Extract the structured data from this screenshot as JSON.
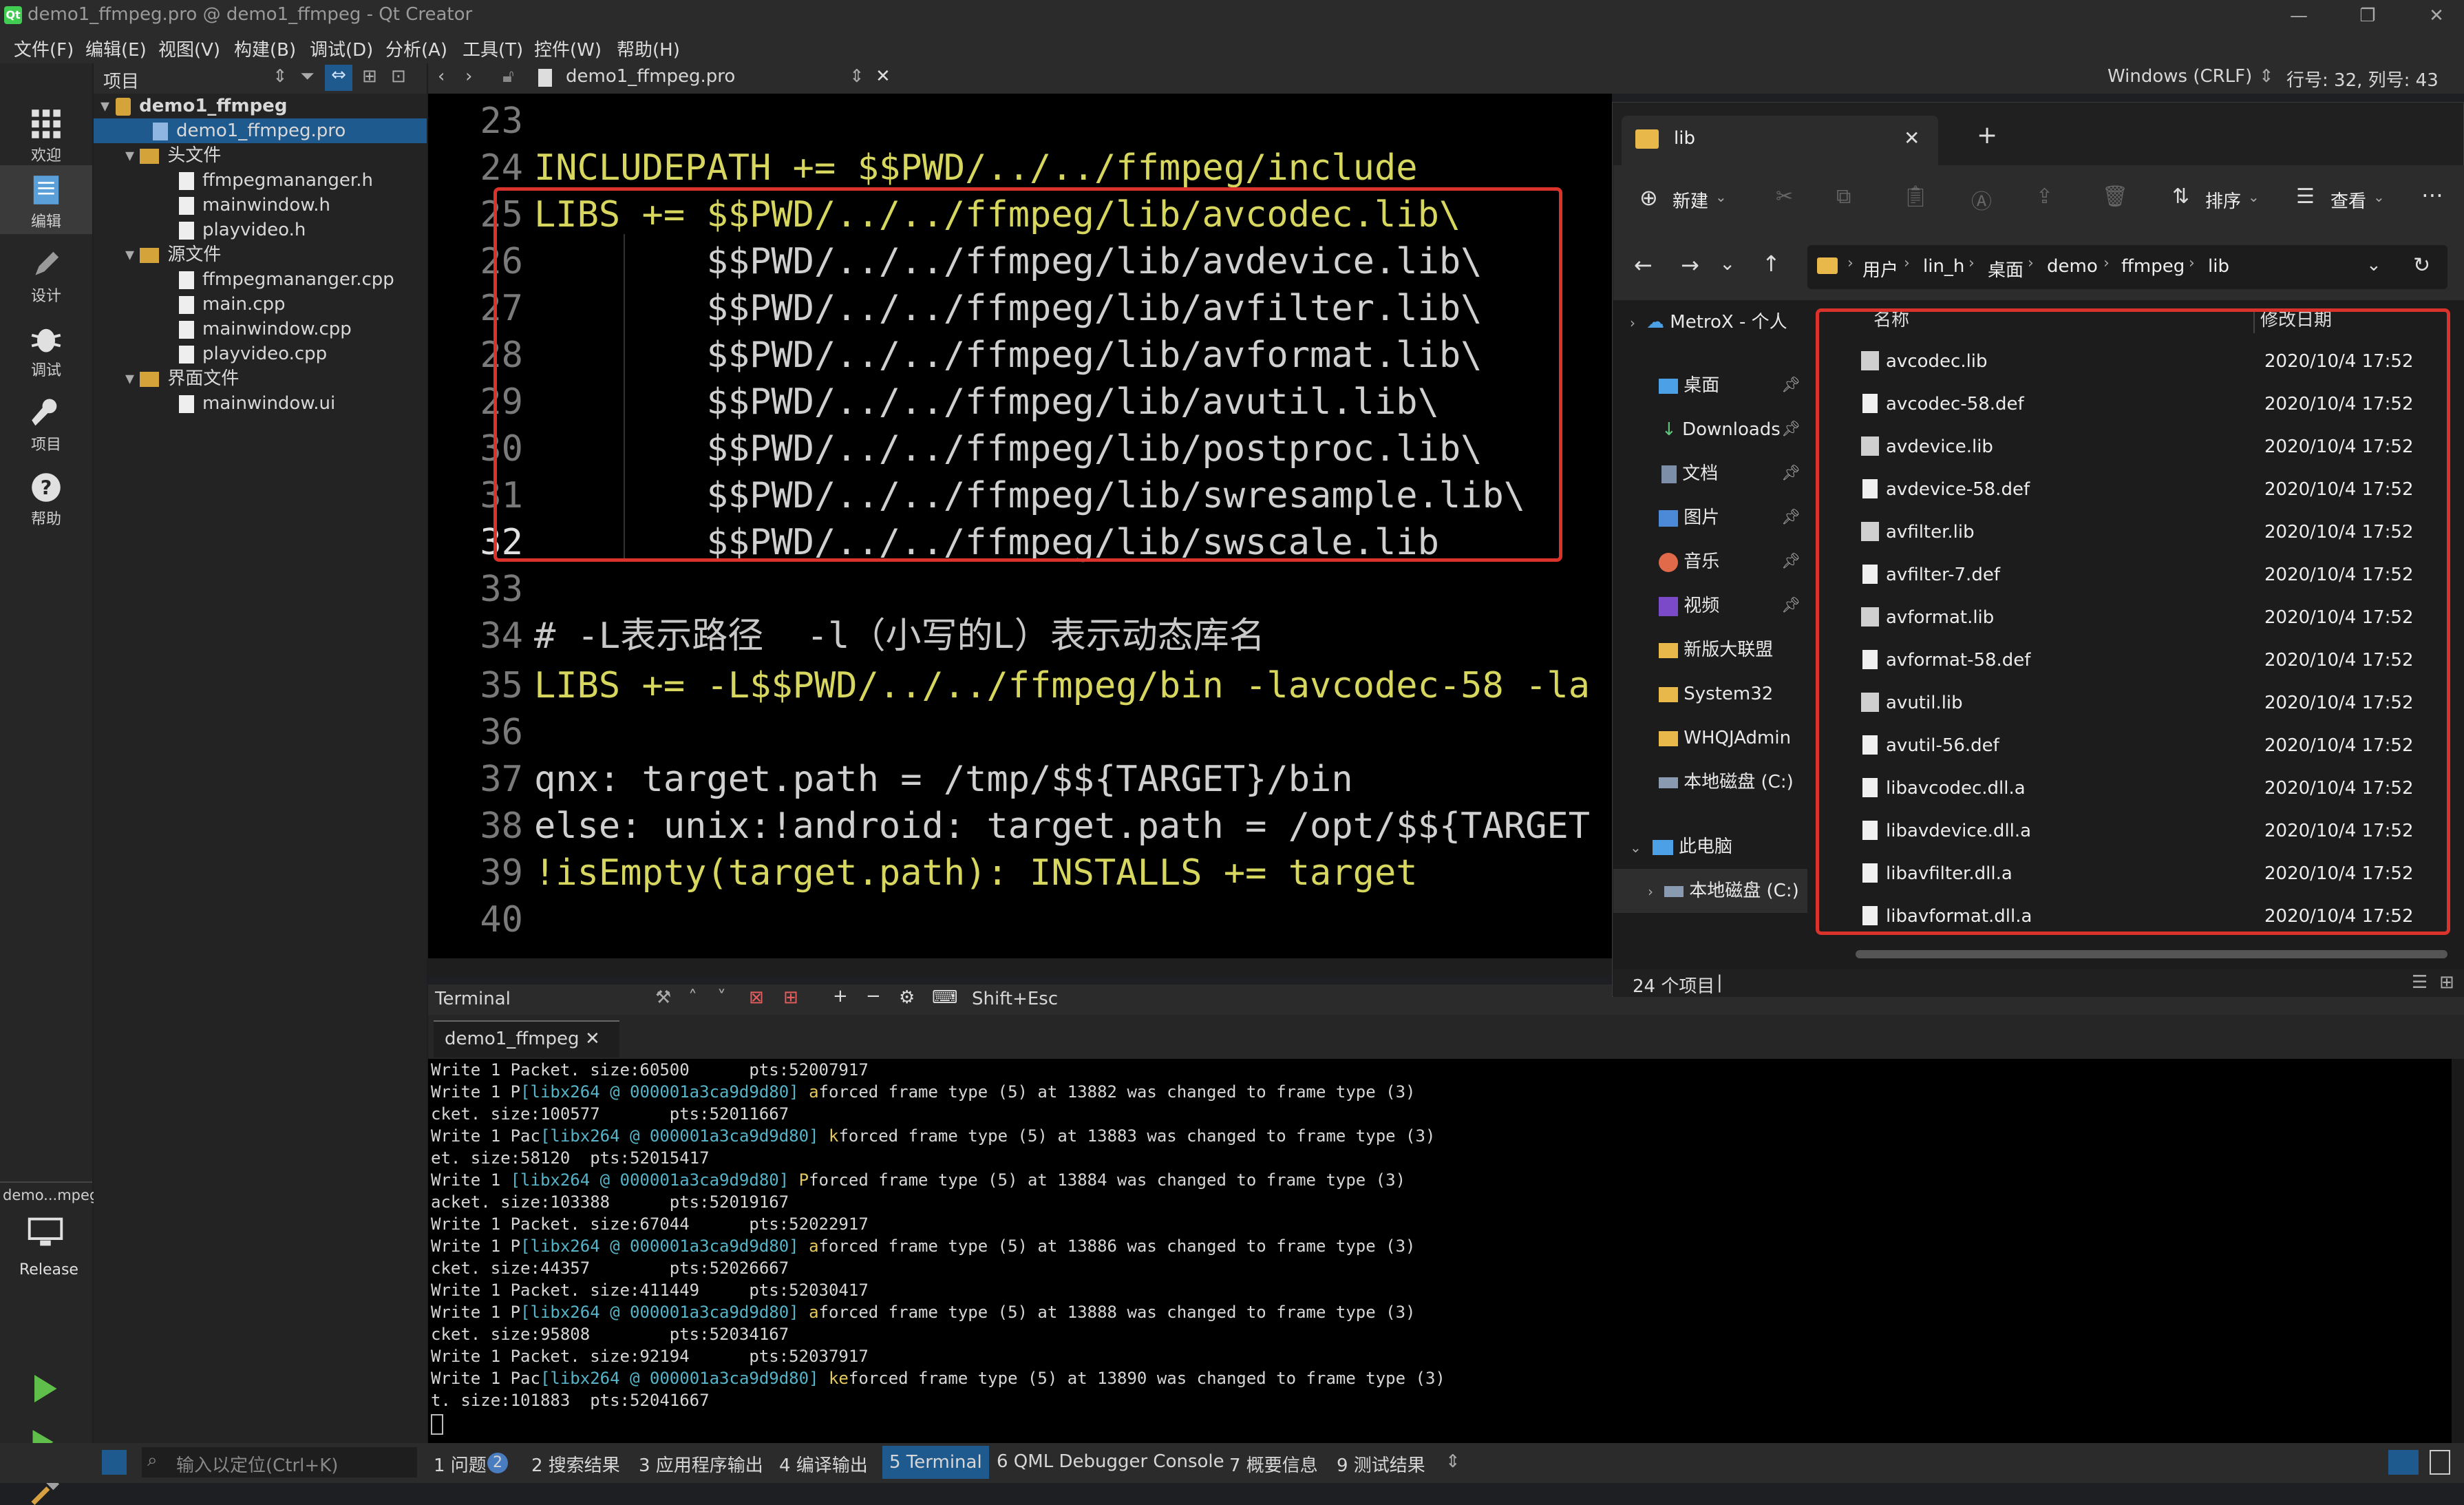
{
  "window": {
    "title": "demo1_ffmpeg.pro @ demo1_ffmpeg - Qt Creator"
  },
  "menu": [
    "文件(F)",
    "编辑(E)",
    "视图(V)",
    "构建(B)",
    "调试(D)",
    "分析(A)",
    "工具(T)",
    "控件(W)",
    "帮助(H)"
  ],
  "modes": [
    "欢迎",
    "编辑",
    "设计",
    "调试",
    "项目",
    "帮助"
  ],
  "kit": {
    "name": "demo...mpeg",
    "config": "Release"
  },
  "project": {
    "header": "项目",
    "tree": [
      {
        "label": "demo1_ffmpeg",
        "indent": 0,
        "kind": "project",
        "bold": true
      },
      {
        "label": "demo1_ffmpeg.pro",
        "indent": 1,
        "kind": "profile",
        "selected": true
      },
      {
        "label": "头文件",
        "indent": 1,
        "kind": "folder"
      },
      {
        "label": "ffmpegmananger.h",
        "indent": 2,
        "kind": "file"
      },
      {
        "label": "mainwindow.h",
        "indent": 2,
        "kind": "file"
      },
      {
        "label": "playvideo.h",
        "indent": 2,
        "kind": "file"
      },
      {
        "label": "源文件",
        "indent": 1,
        "kind": "folder"
      },
      {
        "label": "ffmpegmananger.cpp",
        "indent": 2,
        "kind": "file"
      },
      {
        "label": "main.cpp",
        "indent": 2,
        "kind": "file"
      },
      {
        "label": "mainwindow.cpp",
        "indent": 2,
        "kind": "file"
      },
      {
        "label": "playvideo.cpp",
        "indent": 2,
        "kind": "file"
      },
      {
        "label": "界面文件",
        "indent": 1,
        "kind": "folder"
      },
      {
        "label": "mainwindow.ui",
        "indent": 2,
        "kind": "uifile"
      }
    ]
  },
  "editor": {
    "file_tab": "demo1_ffmpeg.pro",
    "line_ending": "Windows (CRLF)",
    "position": "行号: 32, 列号: 43",
    "lines": [
      {
        "n": "23",
        "text": ""
      },
      {
        "n": "24",
        "text": "INCLUDEPATH += $$PWD/../../ffmpeg/include"
      },
      {
        "n": "25",
        "text": "LIBS += $$PWD/../../ffmpeg/lib/avcodec.lib\\"
      },
      {
        "n": "26",
        "text": "        $$PWD/../../ffmpeg/lib/avdevice.lib\\"
      },
      {
        "n": "27",
        "text": "        $$PWD/../../ffmpeg/lib/avfilter.lib\\"
      },
      {
        "n": "28",
        "text": "        $$PWD/../../ffmpeg/lib/avformat.lib\\"
      },
      {
        "n": "29",
        "text": "        $$PWD/../../ffmpeg/lib/avutil.lib\\"
      },
      {
        "n": "30",
        "text": "        $$PWD/../../ffmpeg/lib/postproc.lib\\"
      },
      {
        "n": "31",
        "text": "        $$PWD/../../ffmpeg/lib/swresample.lib\\"
      },
      {
        "n": "32",
        "text": "        $$PWD/../../ffmpeg/lib/swscale.lib"
      },
      {
        "n": "33",
        "text": ""
      },
      {
        "n": "34",
        "text": "# -L表示路径  -l（小写的L）表示动态库名"
      },
      {
        "n": "35",
        "text": "LIBS += -L$$PWD/../../ffmpeg/bin -lavcodec-58 -la"
      },
      {
        "n": "36",
        "text": ""
      },
      {
        "n": "37",
        "text": "qnx: target.path = /tmp/$${TARGET}/bin"
      },
      {
        "n": "38",
        "text": "else: unix:!android: target.path = /opt/$${TARGET"
      },
      {
        "n": "39",
        "text": "!isEmpty(target.path): INSTALLS += target"
      },
      {
        "n": "40",
        "text": ""
      }
    ]
  },
  "terminal": {
    "title": "Terminal",
    "shortcut": "Shift+Esc",
    "tab": "demo1_ffmpeg",
    "lines": [
      "Write 1 Packet. size:60500      pts:52007917",
      "Write 1 P[libx264 @ 000001a3ca9d9d80] aforced frame type (5) at 13882 was changed to frame type (3)",
      "cket. size:100577       pts:52011667",
      "Write 1 Pac[libx264 @ 000001a3ca9d9d80] kforced frame type (5) at 13883 was changed to frame type (3)",
      "et. size:58120  pts:52015417",
      "Write 1 [libx264 @ 000001a3ca9d9d80] Pforced frame type (5) at 13884 was changed to frame type (3)",
      "acket. size:103388      pts:52019167",
      "Write 1 Packet. size:67044      pts:52022917",
      "Write 1 P[libx264 @ 000001a3ca9d9d80] aforced frame type (5) at 13886 was changed to frame type (3)",
      "cket. size:44357        pts:52026667",
      "Write 1 Packet. size:411449     pts:52030417",
      "Write 1 P[libx264 @ 000001a3ca9d9d80] aforced frame type (5) at 13888 was changed to frame type (3)",
      "cket. size:95808        pts:52034167",
      "Write 1 Packet. size:92194      pts:52037917",
      "Write 1 Pac[libx264 @ 000001a3ca9d9d80] keforced frame type (5) at 13890 was changed to frame type (3)",
      "t. size:101883  pts:52041667"
    ]
  },
  "statusbar": {
    "locator_placeholder": "输入以定位(Ctrl+K)",
    "tabs": [
      "1 问题",
      "2 搜索结果",
      "3 应用程序输出",
      "4 编译输出",
      "5 Terminal",
      "6 QML Debugger Console",
      "7 概要信息",
      "9 测试结果"
    ],
    "issues_count": "2"
  },
  "explorer": {
    "tab_title": "lib",
    "new_label": "新建",
    "sort_label": "排序",
    "view_label": "查看",
    "breadcrumb": [
      "用户",
      "lin_h",
      "桌面",
      "demo",
      "ffmpeg",
      "lib"
    ],
    "col_name": "名称",
    "col_date": "修改日期",
    "status": "24 个项目",
    "sidebar": [
      {
        "label": "MetroX - 个人",
        "icon": "cloud-icon"
      },
      {
        "label": "桌面",
        "icon": "desktop-icon",
        "pinned": true
      },
      {
        "label": "Downloads",
        "icon": "download-icon",
        "pinned": true
      },
      {
        "label": "文档",
        "icon": "document-icon",
        "pinned": true
      },
      {
        "label": "图片",
        "icon": "picture-icon",
        "pinned": true
      },
      {
        "label": "音乐",
        "icon": "music-icon",
        "pinned": true
      },
      {
        "label": "视频",
        "icon": "video-icon",
        "pinned": true
      },
      {
        "label": "新版大联盟",
        "icon": "folder-icon"
      },
      {
        "label": "System32",
        "icon": "folder-icon"
      },
      {
        "label": "WHQJAdmin",
        "icon": "folder-icon"
      },
      {
        "label": "本地磁盘 (C:)",
        "icon": "drive-icon"
      },
      {
        "label": "此电脑",
        "icon": "pc-icon"
      },
      {
        "label": "本地磁盘 (C:)",
        "icon": "drive-icon"
      }
    ],
    "files": [
      {
        "name": "avcodec.lib",
        "date": "2020/10/4 17:52"
      },
      {
        "name": "avcodec-58.def",
        "date": "2020/10/4 17:52"
      },
      {
        "name": "avdevice.lib",
        "date": "2020/10/4 17:52"
      },
      {
        "name": "avdevice-58.def",
        "date": "2020/10/4 17:52"
      },
      {
        "name": "avfilter.lib",
        "date": "2020/10/4 17:52"
      },
      {
        "name": "avfilter-7.def",
        "date": "2020/10/4 17:52"
      },
      {
        "name": "avformat.lib",
        "date": "2020/10/4 17:52"
      },
      {
        "name": "avformat-58.def",
        "date": "2020/10/4 17:52"
      },
      {
        "name": "avutil.lib",
        "date": "2020/10/4 17:52"
      },
      {
        "name": "avutil-56.def",
        "date": "2020/10/4 17:52"
      },
      {
        "name": "libavcodec.dll.a",
        "date": "2020/10/4 17:52"
      },
      {
        "name": "libavdevice.dll.a",
        "date": "2020/10/4 17:52"
      },
      {
        "name": "libavfilter.dll.a",
        "date": "2020/10/4 17:52"
      },
      {
        "name": "libavformat.dll.a",
        "date": "2020/10/4 17:52"
      }
    ]
  },
  "colors": {
    "accent": "#1f5a8f",
    "highlight_box": "#d9332b",
    "keyword": "#d7d75f",
    "terminal_cyan": "#55b4c8"
  }
}
